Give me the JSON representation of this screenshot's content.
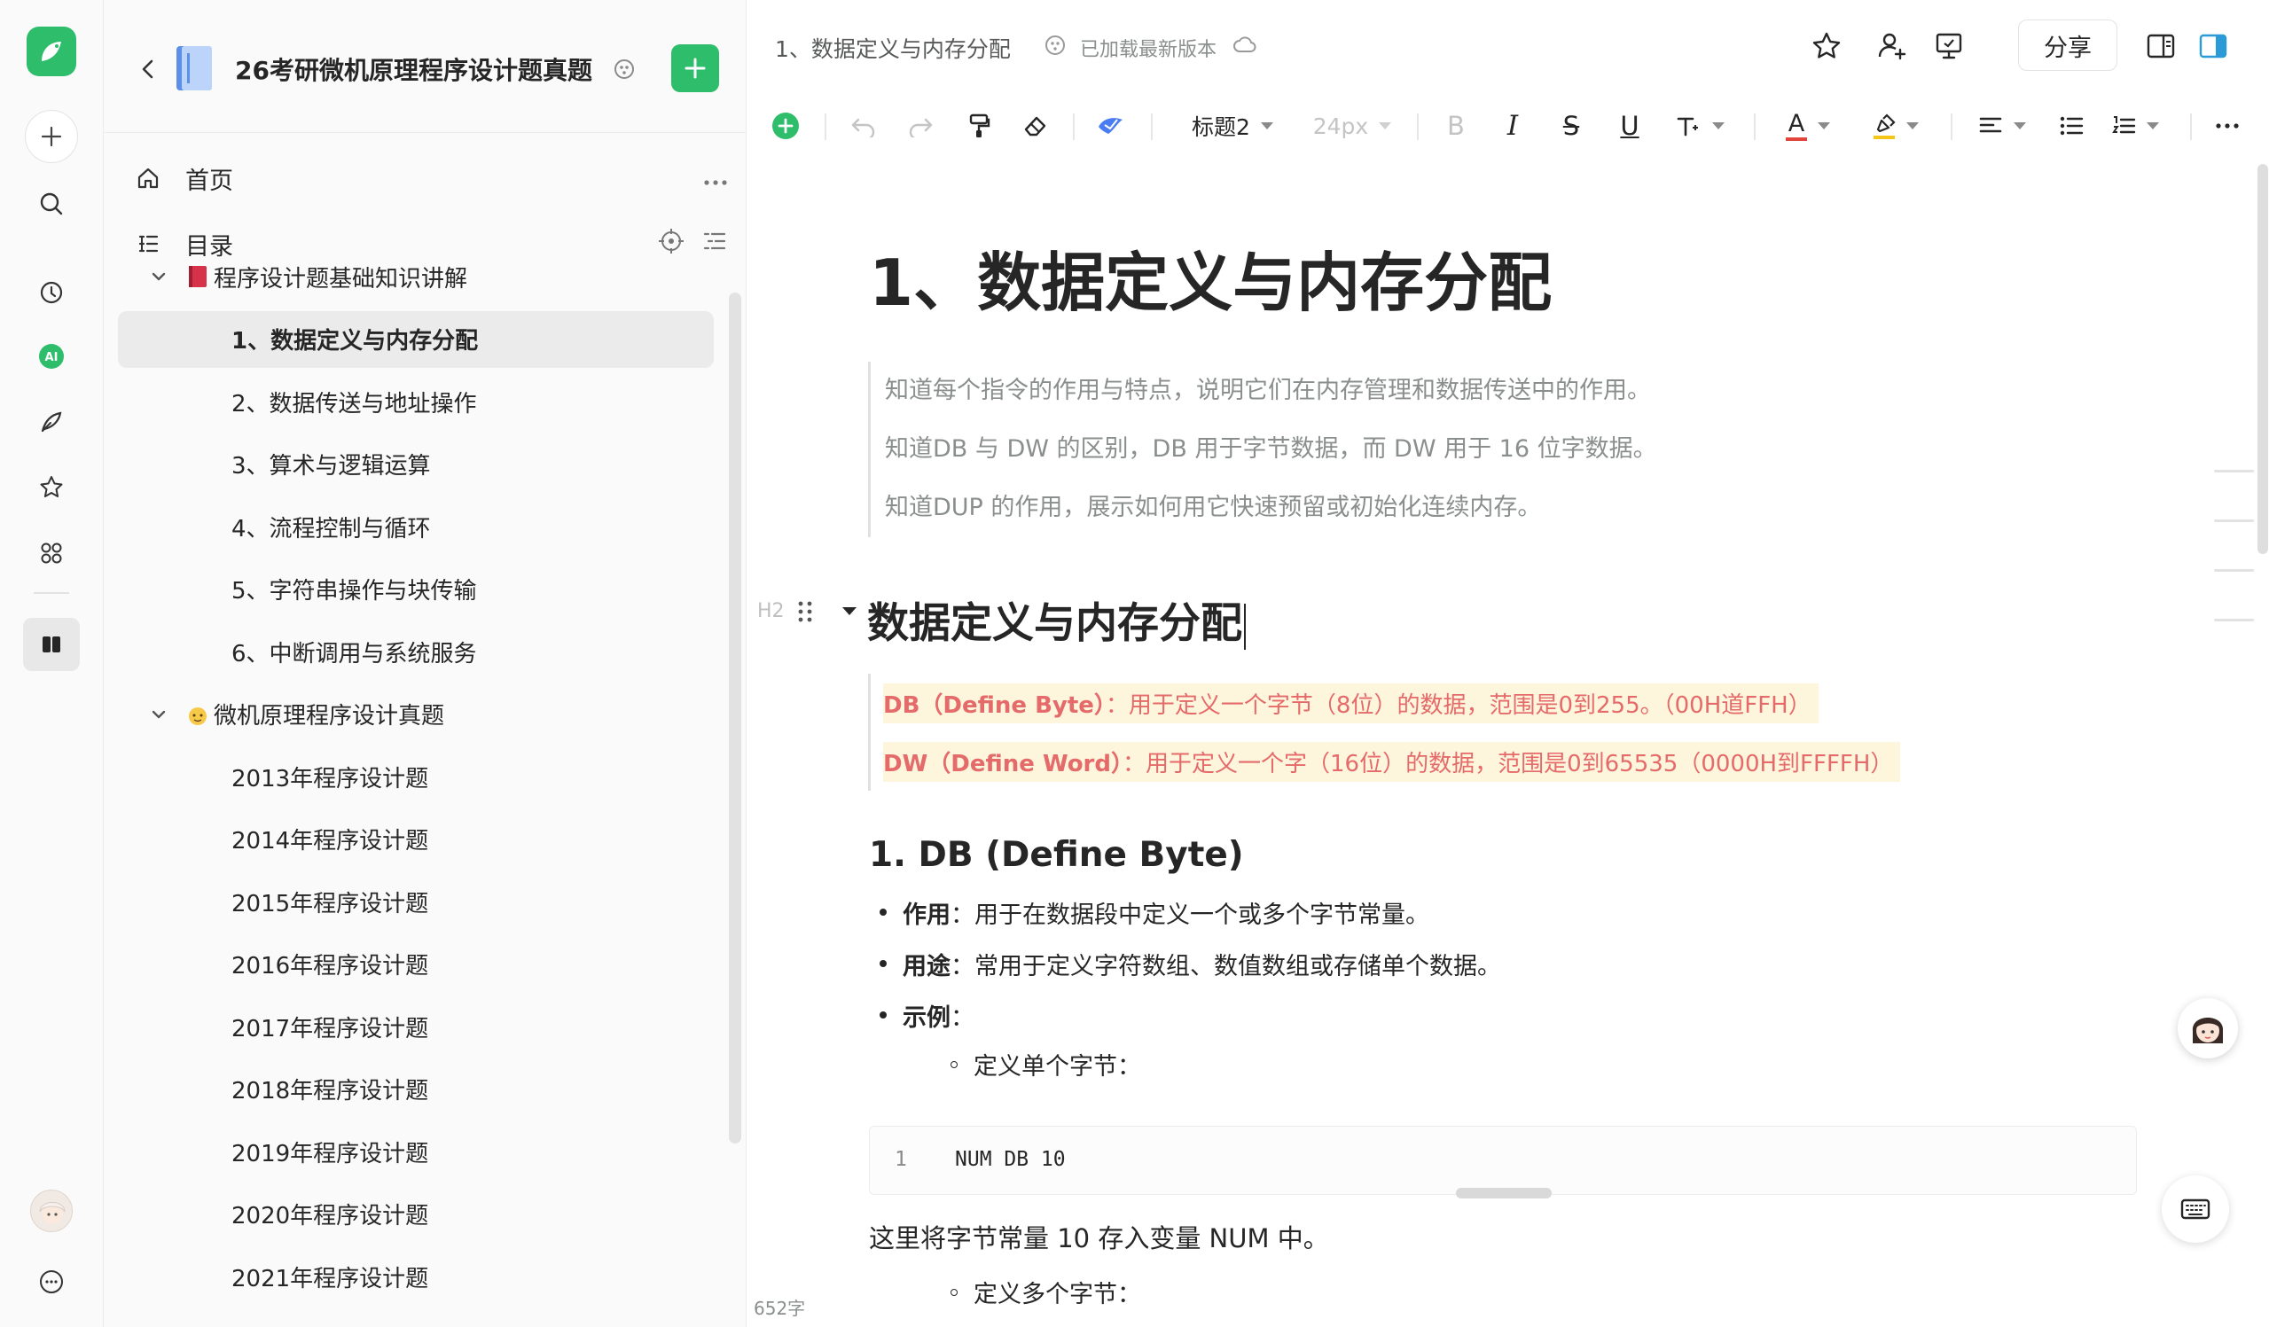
{
  "sidebar": {
    "book_title": "26考研微机原理程序设计题真题",
    "nav": {
      "home_label": "首页",
      "toc_label": "目录"
    },
    "tree": [
      {
        "label": "程序设计题基础知识讲解",
        "level": 0,
        "expanded": true,
        "icon": "red-book-icon"
      },
      {
        "label": "1、数据定义与内存分配",
        "level": 1,
        "selected": true
      },
      {
        "label": "2、数据传送与地址操作",
        "level": 1
      },
      {
        "label": "3、算术与逻辑运算",
        "level": 1
      },
      {
        "label": "4、流程控制与循环",
        "level": 1
      },
      {
        "label": "5、字符串操作与块传输",
        "level": 1
      },
      {
        "label": "6、中断调用与系统服务",
        "level": 1
      },
      {
        "label": "微机原理程序设计真题",
        "level": 0,
        "expanded": true,
        "icon": "face-emoji-icon"
      },
      {
        "label": "2013年程序设计题",
        "level": 1
      },
      {
        "label": "2014年程序设计题",
        "level": 1
      },
      {
        "label": "2015年程序设计题",
        "level": 1
      },
      {
        "label": "2016年程序设计题",
        "level": 1
      },
      {
        "label": "2017年程序设计题",
        "level": 1
      },
      {
        "label": "2018年程序设计题",
        "level": 1
      },
      {
        "label": "2019年程序设计题",
        "level": 1
      },
      {
        "label": "2020年程序设计题",
        "level": 1
      },
      {
        "label": "2021年程序设计题",
        "level": 1
      }
    ]
  },
  "topbar": {
    "breadcrumb": "1、数据定义与内存分配",
    "status": "已加载最新版本",
    "share_label": "分享"
  },
  "toolbar": {
    "heading_style": "标题2",
    "font_size": "24px",
    "bold": "B",
    "italic": "I",
    "strike": "S",
    "underline": "U",
    "font_color_glyph": "A"
  },
  "document": {
    "title": "1、数据定义与内存分配",
    "intro": [
      "知道每个指令的作用与特点，说明它们在内存管理和数据传送中的作用。",
      "知道DB 与 DW 的区别，DB 用于字节数据，而 DW 用于 16 位字数据。",
      "知道DUP 的作用，展示如何用它快速预留或初始化连续内存。"
    ],
    "h2_marker": "H2",
    "h2": "数据定义与内存分配",
    "highlights": [
      {
        "term": "DB（Define Byte）",
        "text": "：用于定义一个字节（8位）的数据，范围是0到255。（00H道FFH）"
      },
      {
        "term": "DW（Define Word）",
        "text": "：用于定义一个字（16位）的数据，范围是0到65535（0000H到FFFFH）"
      }
    ],
    "h3": "1. DB (Define Byte)",
    "bullets": [
      {
        "term": "作用",
        "text": "：用于在数据段中定义一个或多个字节常量。"
      },
      {
        "term": "用途",
        "text": "：常用于定义字符数组、数值数组或存储单个数据。"
      },
      {
        "term": "示例",
        "text": "："
      }
    ],
    "sub_bullet_1": "定义单个字节：",
    "code": {
      "line_no": "1",
      "text": "NUM DB 10"
    },
    "paragraph": "这里将字节常量 10 存入变量 NUM 中。",
    "sub_bullet_2": "定义多个字节：",
    "word_count": "652字"
  },
  "colors": {
    "brand_green": "#2ebd6b",
    "highlight_bg": "#fdf5dc",
    "highlight_text": "#e56a6a"
  }
}
